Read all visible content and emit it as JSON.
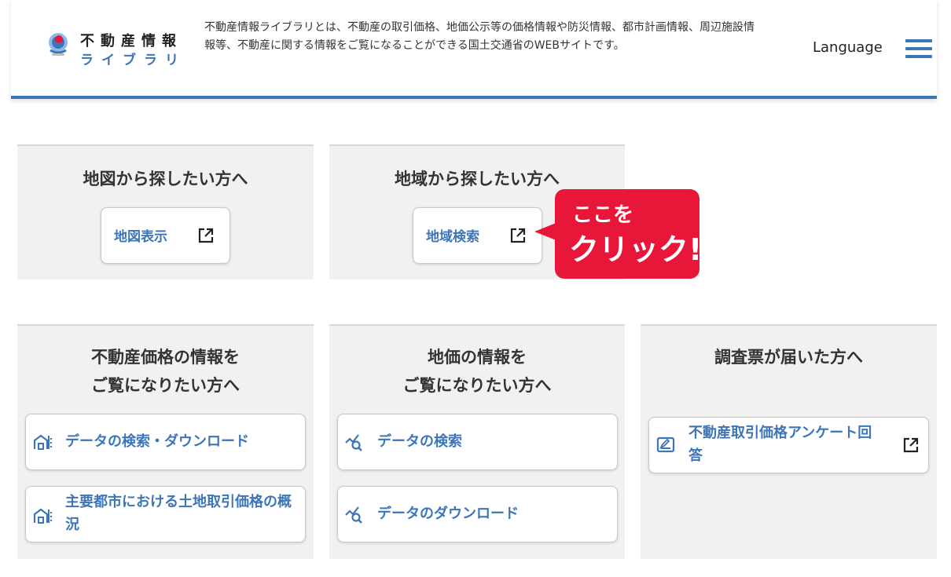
{
  "header": {
    "logo_line1": "不動産情報",
    "logo_line2": "ライブラリ",
    "description": "不動産情報ライブラリとは、不動産の取引価格、地価公示等の価格情報や防災情報、都市計画情報、周辺施設情報等、不動産に関する情報をご覧になることができる国土交通省のWEBサイトです。",
    "language_label": "Language"
  },
  "panels": [
    {
      "title": "地図から探したい方へ",
      "button": "地図表示"
    },
    {
      "title": "地域から探したい方へ",
      "button": "地域検索"
    }
  ],
  "callout": {
    "line1": "ここを",
    "line2": "クリック!"
  },
  "lower_panels": [
    {
      "title_line1": "不動産価格の情報を",
      "title_line2": "ご覧になりたい方へ",
      "buttons": [
        "データの検索・ダウンロード",
        "主要都市における土地取引価格の概況"
      ]
    },
    {
      "title_line1": "地価の情報を",
      "title_line2": "ご覧になりたい方へ",
      "buttons": [
        "データの検索",
        "データのダウンロード"
      ]
    },
    {
      "title_line1": "調査票が届いた方へ",
      "buttons": [
        "不動産取引価格アンケート回答"
      ]
    }
  ],
  "icons": {
    "logo": "library-logo-icon",
    "menu": "hamburger-menu-icon",
    "external": "external-link-icon",
    "building": "building-icon",
    "chart_search": "chart-search-icon",
    "form": "survey-form-icon"
  },
  "colors": {
    "accent": "#3c75b8",
    "callout": "#e8173a",
    "panel_bg": "#f1f1f1"
  }
}
